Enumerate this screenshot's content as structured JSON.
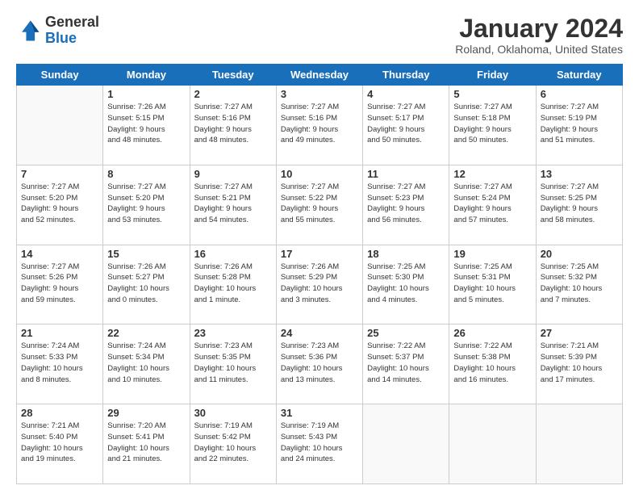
{
  "logo": {
    "general": "General",
    "blue": "Blue"
  },
  "header": {
    "title": "January 2024",
    "location": "Roland, Oklahoma, United States"
  },
  "days_of_week": [
    "Sunday",
    "Monday",
    "Tuesday",
    "Wednesday",
    "Thursday",
    "Friday",
    "Saturday"
  ],
  "weeks": [
    [
      {
        "day": null,
        "info": null
      },
      {
        "day": "1",
        "info": "Sunrise: 7:26 AM\nSunset: 5:15 PM\nDaylight: 9 hours\nand 48 minutes."
      },
      {
        "day": "2",
        "info": "Sunrise: 7:27 AM\nSunset: 5:16 PM\nDaylight: 9 hours\nand 48 minutes."
      },
      {
        "day": "3",
        "info": "Sunrise: 7:27 AM\nSunset: 5:16 PM\nDaylight: 9 hours\nand 49 minutes."
      },
      {
        "day": "4",
        "info": "Sunrise: 7:27 AM\nSunset: 5:17 PM\nDaylight: 9 hours\nand 50 minutes."
      },
      {
        "day": "5",
        "info": "Sunrise: 7:27 AM\nSunset: 5:18 PM\nDaylight: 9 hours\nand 50 minutes."
      },
      {
        "day": "6",
        "info": "Sunrise: 7:27 AM\nSunset: 5:19 PM\nDaylight: 9 hours\nand 51 minutes."
      }
    ],
    [
      {
        "day": "7",
        "info": "Sunrise: 7:27 AM\nSunset: 5:20 PM\nDaylight: 9 hours\nand 52 minutes."
      },
      {
        "day": "8",
        "info": "Sunrise: 7:27 AM\nSunset: 5:20 PM\nDaylight: 9 hours\nand 53 minutes."
      },
      {
        "day": "9",
        "info": "Sunrise: 7:27 AM\nSunset: 5:21 PM\nDaylight: 9 hours\nand 54 minutes."
      },
      {
        "day": "10",
        "info": "Sunrise: 7:27 AM\nSunset: 5:22 PM\nDaylight: 9 hours\nand 55 minutes."
      },
      {
        "day": "11",
        "info": "Sunrise: 7:27 AM\nSunset: 5:23 PM\nDaylight: 9 hours\nand 56 minutes."
      },
      {
        "day": "12",
        "info": "Sunrise: 7:27 AM\nSunset: 5:24 PM\nDaylight: 9 hours\nand 57 minutes."
      },
      {
        "day": "13",
        "info": "Sunrise: 7:27 AM\nSunset: 5:25 PM\nDaylight: 9 hours\nand 58 minutes."
      }
    ],
    [
      {
        "day": "14",
        "info": "Sunrise: 7:27 AM\nSunset: 5:26 PM\nDaylight: 9 hours\nand 59 minutes."
      },
      {
        "day": "15",
        "info": "Sunrise: 7:26 AM\nSunset: 5:27 PM\nDaylight: 10 hours\nand 0 minutes."
      },
      {
        "day": "16",
        "info": "Sunrise: 7:26 AM\nSunset: 5:28 PM\nDaylight: 10 hours\nand 1 minute."
      },
      {
        "day": "17",
        "info": "Sunrise: 7:26 AM\nSunset: 5:29 PM\nDaylight: 10 hours\nand 3 minutes."
      },
      {
        "day": "18",
        "info": "Sunrise: 7:25 AM\nSunset: 5:30 PM\nDaylight: 10 hours\nand 4 minutes."
      },
      {
        "day": "19",
        "info": "Sunrise: 7:25 AM\nSunset: 5:31 PM\nDaylight: 10 hours\nand 5 minutes."
      },
      {
        "day": "20",
        "info": "Sunrise: 7:25 AM\nSunset: 5:32 PM\nDaylight: 10 hours\nand 7 minutes."
      }
    ],
    [
      {
        "day": "21",
        "info": "Sunrise: 7:24 AM\nSunset: 5:33 PM\nDaylight: 10 hours\nand 8 minutes."
      },
      {
        "day": "22",
        "info": "Sunrise: 7:24 AM\nSunset: 5:34 PM\nDaylight: 10 hours\nand 10 minutes."
      },
      {
        "day": "23",
        "info": "Sunrise: 7:23 AM\nSunset: 5:35 PM\nDaylight: 10 hours\nand 11 minutes."
      },
      {
        "day": "24",
        "info": "Sunrise: 7:23 AM\nSunset: 5:36 PM\nDaylight: 10 hours\nand 13 minutes."
      },
      {
        "day": "25",
        "info": "Sunrise: 7:22 AM\nSunset: 5:37 PM\nDaylight: 10 hours\nand 14 minutes."
      },
      {
        "day": "26",
        "info": "Sunrise: 7:22 AM\nSunset: 5:38 PM\nDaylight: 10 hours\nand 16 minutes."
      },
      {
        "day": "27",
        "info": "Sunrise: 7:21 AM\nSunset: 5:39 PM\nDaylight: 10 hours\nand 17 minutes."
      }
    ],
    [
      {
        "day": "28",
        "info": "Sunrise: 7:21 AM\nSunset: 5:40 PM\nDaylight: 10 hours\nand 19 minutes."
      },
      {
        "day": "29",
        "info": "Sunrise: 7:20 AM\nSunset: 5:41 PM\nDaylight: 10 hours\nand 21 minutes."
      },
      {
        "day": "30",
        "info": "Sunrise: 7:19 AM\nSunset: 5:42 PM\nDaylight: 10 hours\nand 22 minutes."
      },
      {
        "day": "31",
        "info": "Sunrise: 7:19 AM\nSunset: 5:43 PM\nDaylight: 10 hours\nand 24 minutes."
      },
      {
        "day": null,
        "info": null
      },
      {
        "day": null,
        "info": null
      },
      {
        "day": null,
        "info": null
      }
    ]
  ]
}
